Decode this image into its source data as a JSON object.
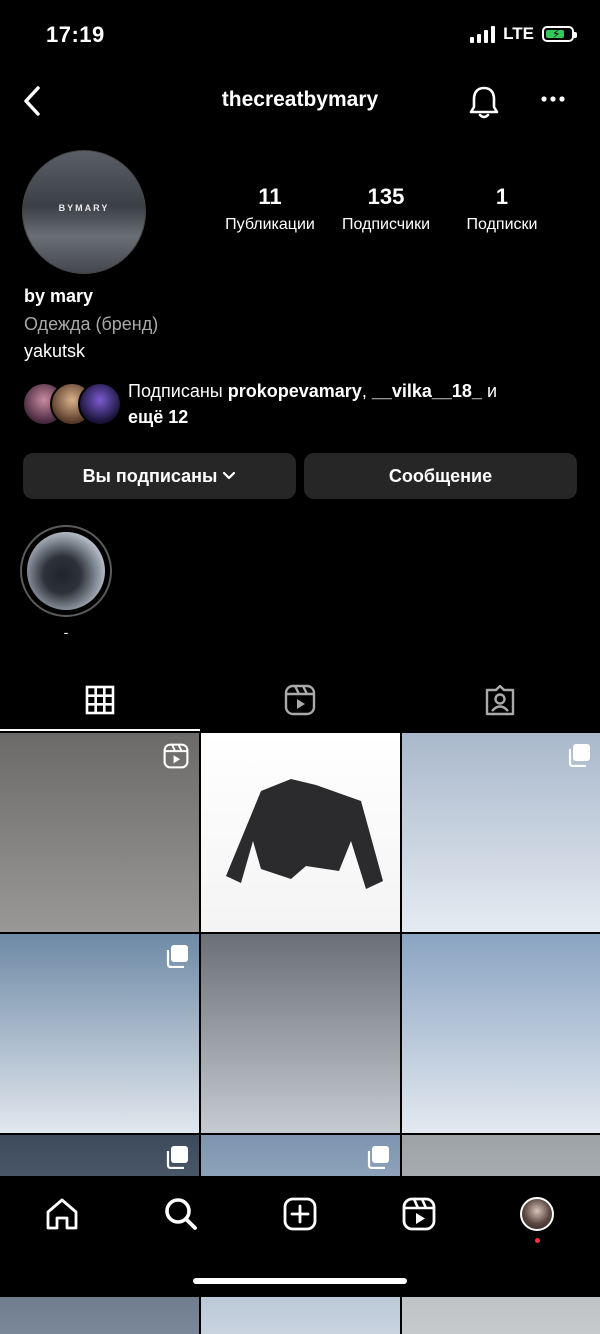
{
  "status_bar": {
    "time": "17:19",
    "network": "LTE",
    "battery_level_percent": 60,
    "charging": true
  },
  "header": {
    "username": "thecreatbymary",
    "back_icon": "chevron-left-icon",
    "bell_icon": "bell-icon",
    "more_icon": "more-horizontal-icon"
  },
  "profile": {
    "avatar_text": "BYMARY",
    "stats": [
      {
        "value": "11",
        "label": "Публикации"
      },
      {
        "value": "135",
        "label": "Подписчики"
      },
      {
        "value": "1",
        "label": "Подписки"
      }
    ],
    "name": "by mary",
    "category": "Одежда (бренд)",
    "bio": "yakutsk",
    "followed_by": {
      "prefix": "Подписаны ",
      "user1": "prokopevamary",
      "sep": ", ",
      "user2": "__vilka__18_",
      "and": " и",
      "more": "ещё 12"
    }
  },
  "actions": {
    "following_label": "Вы подписаны",
    "message_label": "Сообщение"
  },
  "highlights": [
    {
      "label": "-"
    }
  ],
  "tabs": [
    {
      "name": "grid",
      "icon": "grid-icon",
      "active": true
    },
    {
      "name": "reels",
      "icon": "reels-icon",
      "active": false
    },
    {
      "name": "tagged",
      "icon": "tagged-person-icon",
      "active": false
    }
  ],
  "posts": [
    {
      "type": "reel",
      "colors": [
        "#6c6a68",
        "#9a9896"
      ]
    },
    {
      "type": "photo",
      "colors": [
        "#ffffff",
        "#f4f4f4"
      ]
    },
    {
      "type": "carousel",
      "colors": [
        "#a9b8cb",
        "#e5ebf2"
      ]
    },
    {
      "type": "carousel",
      "colors": [
        "#6e8aa6",
        "#e1e7ee"
      ]
    },
    {
      "type": "photo",
      "colors": [
        "#6b7076",
        "#c6cbd1"
      ]
    },
    {
      "type": "photo",
      "colors": [
        "#8aa4c2",
        "#e3e9f0"
      ]
    },
    {
      "type": "carousel",
      "colors": [
        "#3d4a5c",
        "#7b8899"
      ]
    },
    {
      "type": "carousel",
      "colors": [
        "#7d95b0",
        "#c9d4e0"
      ]
    },
    {
      "type": "photo",
      "colors": [
        "#9ea3a7",
        "#c7cacc"
      ]
    }
  ],
  "bottom_nav": [
    "home-icon",
    "search-icon",
    "add-post-icon",
    "reels-icon",
    "profile-avatar"
  ],
  "colors": {
    "background": "#000000",
    "button": "#262626",
    "muted_text": "#a8a8a8",
    "battery": "#34c759",
    "notification_dot": "#ff3040"
  }
}
